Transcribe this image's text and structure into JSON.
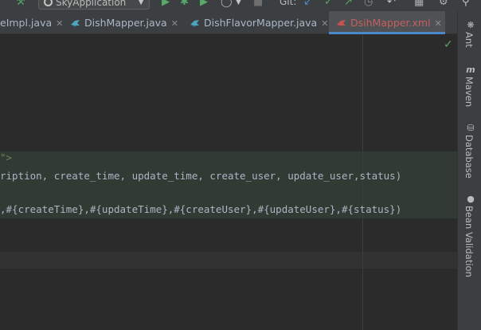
{
  "toolbar": {
    "run_config": "SkyApplication",
    "git_label": "Git:"
  },
  "tabs": [
    {
      "label": "eImpl.java",
      "active": false
    },
    {
      "label": "DishMapper.java",
      "active": false
    },
    {
      "label": "DishFlavorMapper.java",
      "active": false
    },
    {
      "label": "DsihMapper.xml",
      "active": true
    }
  ],
  "editor": {
    "lines": [
      {
        "text": "\">"
      },
      {
        "text": "ription, create_time, update_time, create_user, update_user,status)"
      },
      {
        "text": ",#{createTime},#{updateTime},#{createUser},#{updateUser},#{status})"
      }
    ]
  },
  "tool_strip": [
    {
      "label": "Ant",
      "icon": "ant-icon"
    },
    {
      "label": "Maven",
      "icon": "maven-icon"
    },
    {
      "label": "Database",
      "icon": "database-icon"
    },
    {
      "label": "Bean Validation",
      "icon": "bean-validation-icon"
    }
  ],
  "colors": {
    "accent": "#4a88c7",
    "xml_tab_text": "#c95e5e",
    "string": "#6a8759",
    "ok_check": "#59a869"
  }
}
